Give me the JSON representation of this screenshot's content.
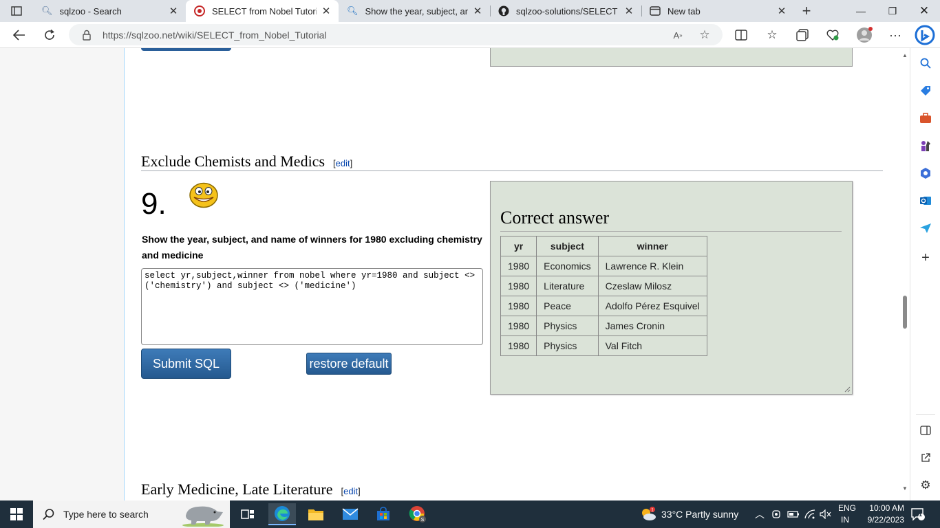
{
  "browser": {
    "tabs": [
      {
        "title": "sqlzoo - Search",
        "icon": "search-icon"
      },
      {
        "title": "SELECT from Nobel Tutorial - SQLZoo",
        "icon": "sqlzoo-icon"
      },
      {
        "title": "Show the year, subject, and name",
        "icon": "search-icon"
      },
      {
        "title": "sqlzoo-solutions/SELECT - nobel",
        "icon": "github-icon"
      },
      {
        "title": "New tab",
        "icon": "newtab-icon"
      }
    ],
    "url": "https://sqlzoo.net/wiki/SELECT_from_Nobel_Tutorial"
  },
  "page": {
    "section_title": "Exclude Chemists and Medics",
    "edit_label": "edit",
    "question_number": "9.",
    "question_text": "Show the year, subject, and name of winners for 1980 excluding chemistry and medicine",
    "sql": "select yr,subject,winner from nobel where yr=1980 and subject <> ('chemistry') and subject <> ('medicine')",
    "submit_label": "Submit SQL",
    "restore_label": "restore default",
    "answer_title": "Correct answer",
    "next_section_title": "Early Medicine, Late Literature"
  },
  "results": {
    "columns": [
      "yr",
      "subject",
      "winner"
    ],
    "rows": [
      [
        "1980",
        "Economics",
        "Lawrence R. Klein"
      ],
      [
        "1980",
        "Literature",
        "Czeslaw Milosz"
      ],
      [
        "1980",
        "Peace",
        "Adolfo Pérez Esquivel"
      ],
      [
        "1980",
        "Physics",
        "James Cronin"
      ],
      [
        "1980",
        "Physics",
        "Val Fitch"
      ]
    ]
  },
  "taskbar": {
    "search_placeholder": "Type here to search",
    "weather": "33°C  Partly sunny",
    "lang_top": "ENG",
    "lang_bottom": "IN",
    "time": "10:00 AM",
    "date": "9/22/2023",
    "notification_count": "1"
  },
  "colors": {
    "answer_bg": "#dbe3d8",
    "button_blue": "#2f6ca6",
    "taskbar_bg": "#1f2f3c"
  }
}
